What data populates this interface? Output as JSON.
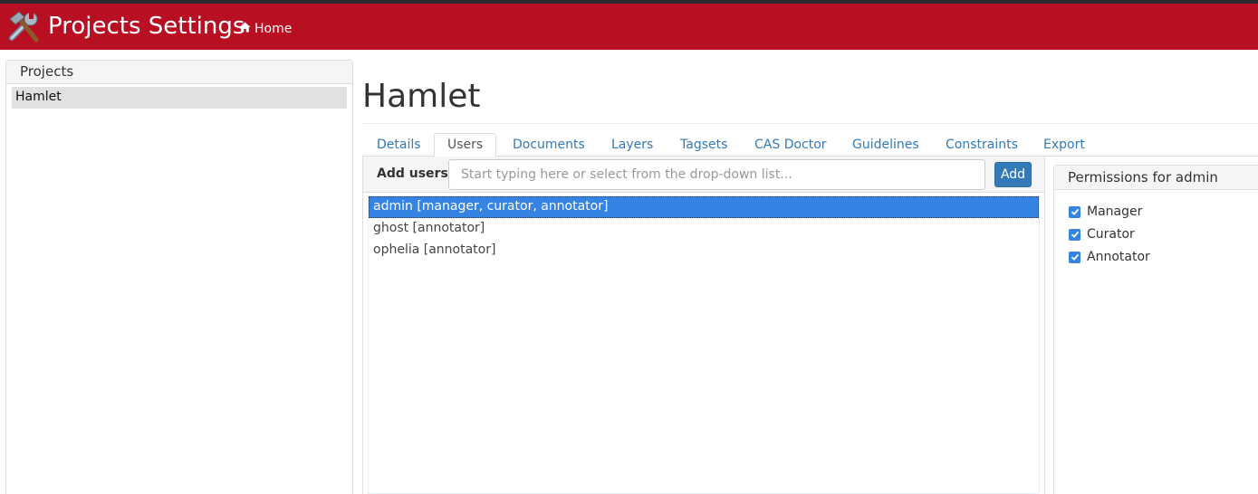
{
  "header": {
    "title": "Projects Settings",
    "logo_icon": "tools-icon",
    "home_label": "Home",
    "home_icon": "home-icon",
    "bar_color": "#b90f22"
  },
  "projects": {
    "heading": "Projects",
    "items": [
      {
        "label": "Hamlet",
        "selected": true
      }
    ]
  },
  "main": {
    "title": "Hamlet",
    "tabs": [
      {
        "label": "Details",
        "active": false
      },
      {
        "label": "Users",
        "active": true
      },
      {
        "label": "Documents",
        "active": false
      },
      {
        "label": "Layers",
        "active": false
      },
      {
        "label": "Tagsets",
        "active": false
      },
      {
        "label": "CAS Doctor",
        "active": false
      },
      {
        "label": "Guidelines",
        "active": false
      },
      {
        "label": "Constraints",
        "active": false
      },
      {
        "label": "Export",
        "active": false
      }
    ]
  },
  "users": {
    "add_label": "Add users",
    "input_placeholder": "Start typing here or select from the drop-down list...",
    "add_button": "Add",
    "list": [
      {
        "label": "admin [manager, curator, annotator]",
        "selected": true
      },
      {
        "label": "ghost [annotator]",
        "selected": false
      },
      {
        "label": "ophelia [annotator]",
        "selected": false
      }
    ]
  },
  "permissions": {
    "heading": "Permissions for admin",
    "items": [
      {
        "label": "Manager",
        "checked": true
      },
      {
        "label": "Curator",
        "checked": true
      },
      {
        "label": "Annotator",
        "checked": true
      }
    ]
  },
  "colors": {
    "accent": "#337ab7",
    "selection": "#3584e4"
  }
}
